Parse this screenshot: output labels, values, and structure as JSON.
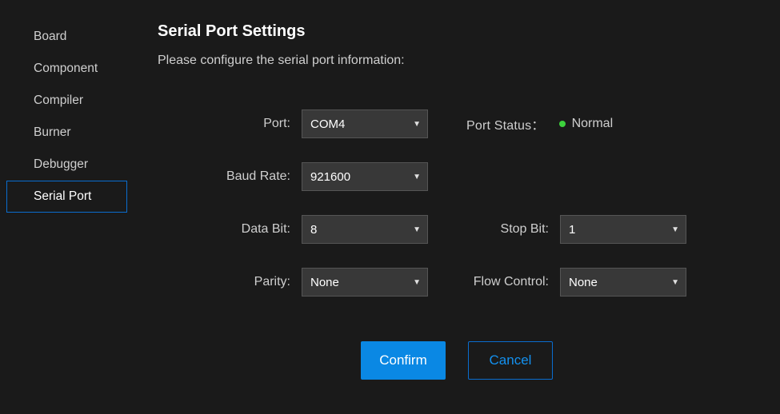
{
  "sidebar": {
    "items": [
      {
        "label": "Board"
      },
      {
        "label": "Component"
      },
      {
        "label": "Compiler"
      },
      {
        "label": "Burner"
      },
      {
        "label": "Debugger"
      },
      {
        "label": "Serial Port"
      }
    ],
    "active_index": 5
  },
  "main": {
    "title": "Serial Port Settings",
    "subtitle": "Please configure the serial port information:"
  },
  "fields": {
    "port": {
      "label": "Port:",
      "value": "COM4"
    },
    "port_status": {
      "label": "Port Status：",
      "value": "Normal",
      "color": "#3cd13c"
    },
    "baud_rate": {
      "label": "Baud Rate:",
      "value": "921600"
    },
    "data_bit": {
      "label": "Data Bit:",
      "value": "8"
    },
    "stop_bit": {
      "label": "Stop Bit:",
      "value": "1"
    },
    "parity": {
      "label": "Parity:",
      "value": "None"
    },
    "flow_control": {
      "label": "Flow Control:",
      "value": "None"
    }
  },
  "buttons": {
    "confirm": "Confirm",
    "cancel": "Cancel"
  }
}
